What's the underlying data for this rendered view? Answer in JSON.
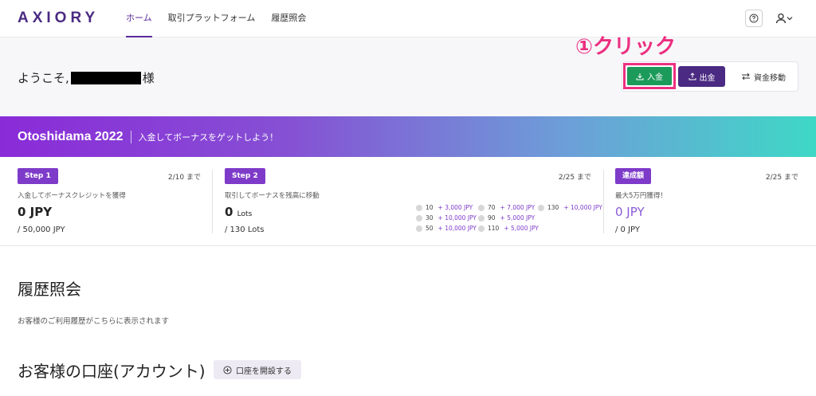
{
  "header": {
    "logo": "AXIORY",
    "nav": [
      {
        "label": "ホーム",
        "active": true
      },
      {
        "label": "取引プラットフォーム",
        "active": false
      },
      {
        "label": "履歴照会",
        "active": false
      }
    ],
    "help_icon": "question-circle-icon",
    "user_icon": "user-icon"
  },
  "welcome": {
    "prefix": "ようこそ,",
    "suffix": "様"
  },
  "annotation": "①クリック",
  "actions": {
    "deposit_label": "入金",
    "withdraw_label": "出金",
    "transfer_label": "資金移動"
  },
  "colors": {
    "brand": "#4a2a82",
    "deposit": "#1b9a5a",
    "annotation": "#ec2f80",
    "badge": "#7e3bc9"
  },
  "banner": {
    "title": "Otoshidama 2022",
    "subtitle": "入金してボーナスをゲットしよう！"
  },
  "steps": [
    {
      "badge": "Step 1",
      "deadline": "2/10 まで",
      "desc": "入金してボーナスクレジットを獲得",
      "value": "0 JPY",
      "total": "/ 50,000 JPY"
    },
    {
      "badge": "Step 2",
      "deadline": "2/25 まで",
      "desc": "取引してボーナスを残高に移動",
      "value": "0",
      "value_unit": "Lots",
      "total": "/ 130 Lots",
      "tiers": [
        {
          "lots": "10",
          "bonus": "+ 3,000 JPY"
        },
        {
          "lots": "30",
          "bonus": "+ 10,000 JPY"
        },
        {
          "lots": "50",
          "bonus": "+ 10,000 JPY"
        },
        {
          "lots": "70",
          "bonus": "+ 7,000 JPY"
        },
        {
          "lots": "90",
          "bonus": "+ 5,000 JPY"
        },
        {
          "lots": "110",
          "bonus": "+ 5,000 JPY"
        },
        {
          "lots": "130",
          "bonus": "+ 10,000 JPY"
        }
      ]
    },
    {
      "badge": "達成額",
      "deadline": "2/25 まで",
      "desc": "最大5万円獲得！",
      "value": "0 JPY",
      "total": "/ 0 JPY"
    }
  ],
  "history": {
    "title": "履歴照会",
    "desc": "お客様のご利用履歴がこちらに表示されます"
  },
  "accounts": {
    "title": "お客様の口座(アカウント)",
    "open_button": "口座を開設する"
  }
}
